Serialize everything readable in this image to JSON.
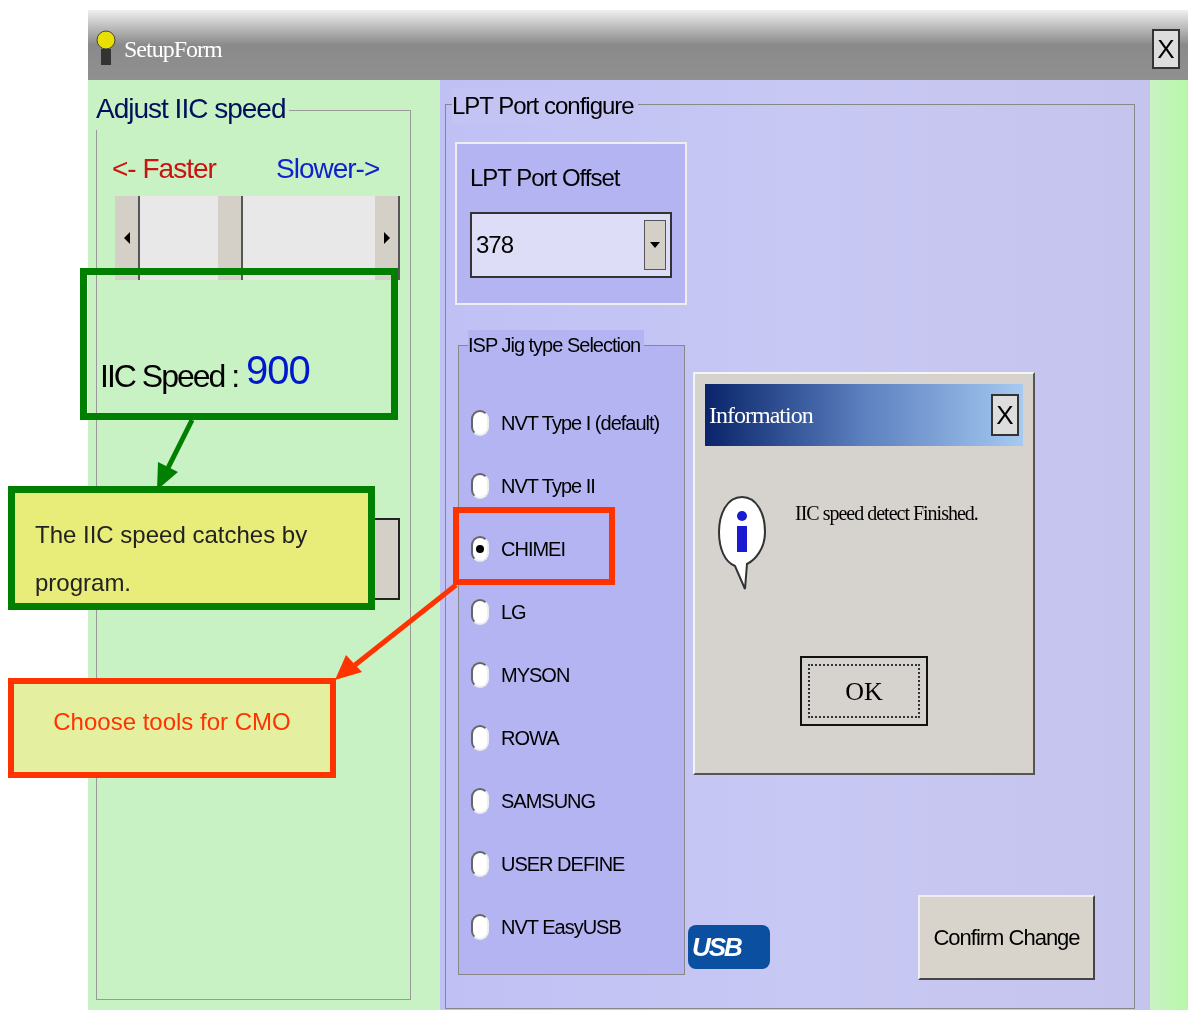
{
  "window": {
    "title": "SetupForm",
    "close": "X"
  },
  "speed_group": {
    "legend": "Adjust IIC speed",
    "faster": "<- Faster",
    "slower": "Slower->",
    "slider": {
      "level": 0.37
    },
    "speed_label": "IIC Speed :",
    "speed_value": "900"
  },
  "lpt_group": {
    "legend": "LPT Port configure",
    "offset_label": "LPT Port Offset",
    "offset_value": "378"
  },
  "jig_group": {
    "legend": "ISP Jig type Selection",
    "options": [
      {
        "label": "NVT Type I (default)",
        "selected": false
      },
      {
        "label": "NVT Type II",
        "selected": false
      },
      {
        "label": "CHIMEI",
        "selected": true
      },
      {
        "label": "LG",
        "selected": false
      },
      {
        "label": "MYSON",
        "selected": false
      },
      {
        "label": "ROWA",
        "selected": false
      },
      {
        "label": "SAMSUNG",
        "selected": false
      },
      {
        "label": "USER DEFINE",
        "selected": false
      },
      {
        "label": "NVT EasyUSB",
        "selected": false
      }
    ]
  },
  "usb_logo": "USB",
  "confirm_button": "Confirm Change",
  "info_dialog": {
    "title": "Information",
    "close": "X",
    "message": "IIC speed detect Finished.",
    "ok": "OK"
  },
  "annotations": [
    {
      "text": "The IIC speed catches by program.",
      "color": "#007f00"
    },
    {
      "text": "Choose tools for CMO",
      "color": "#ff3300"
    }
  ]
}
